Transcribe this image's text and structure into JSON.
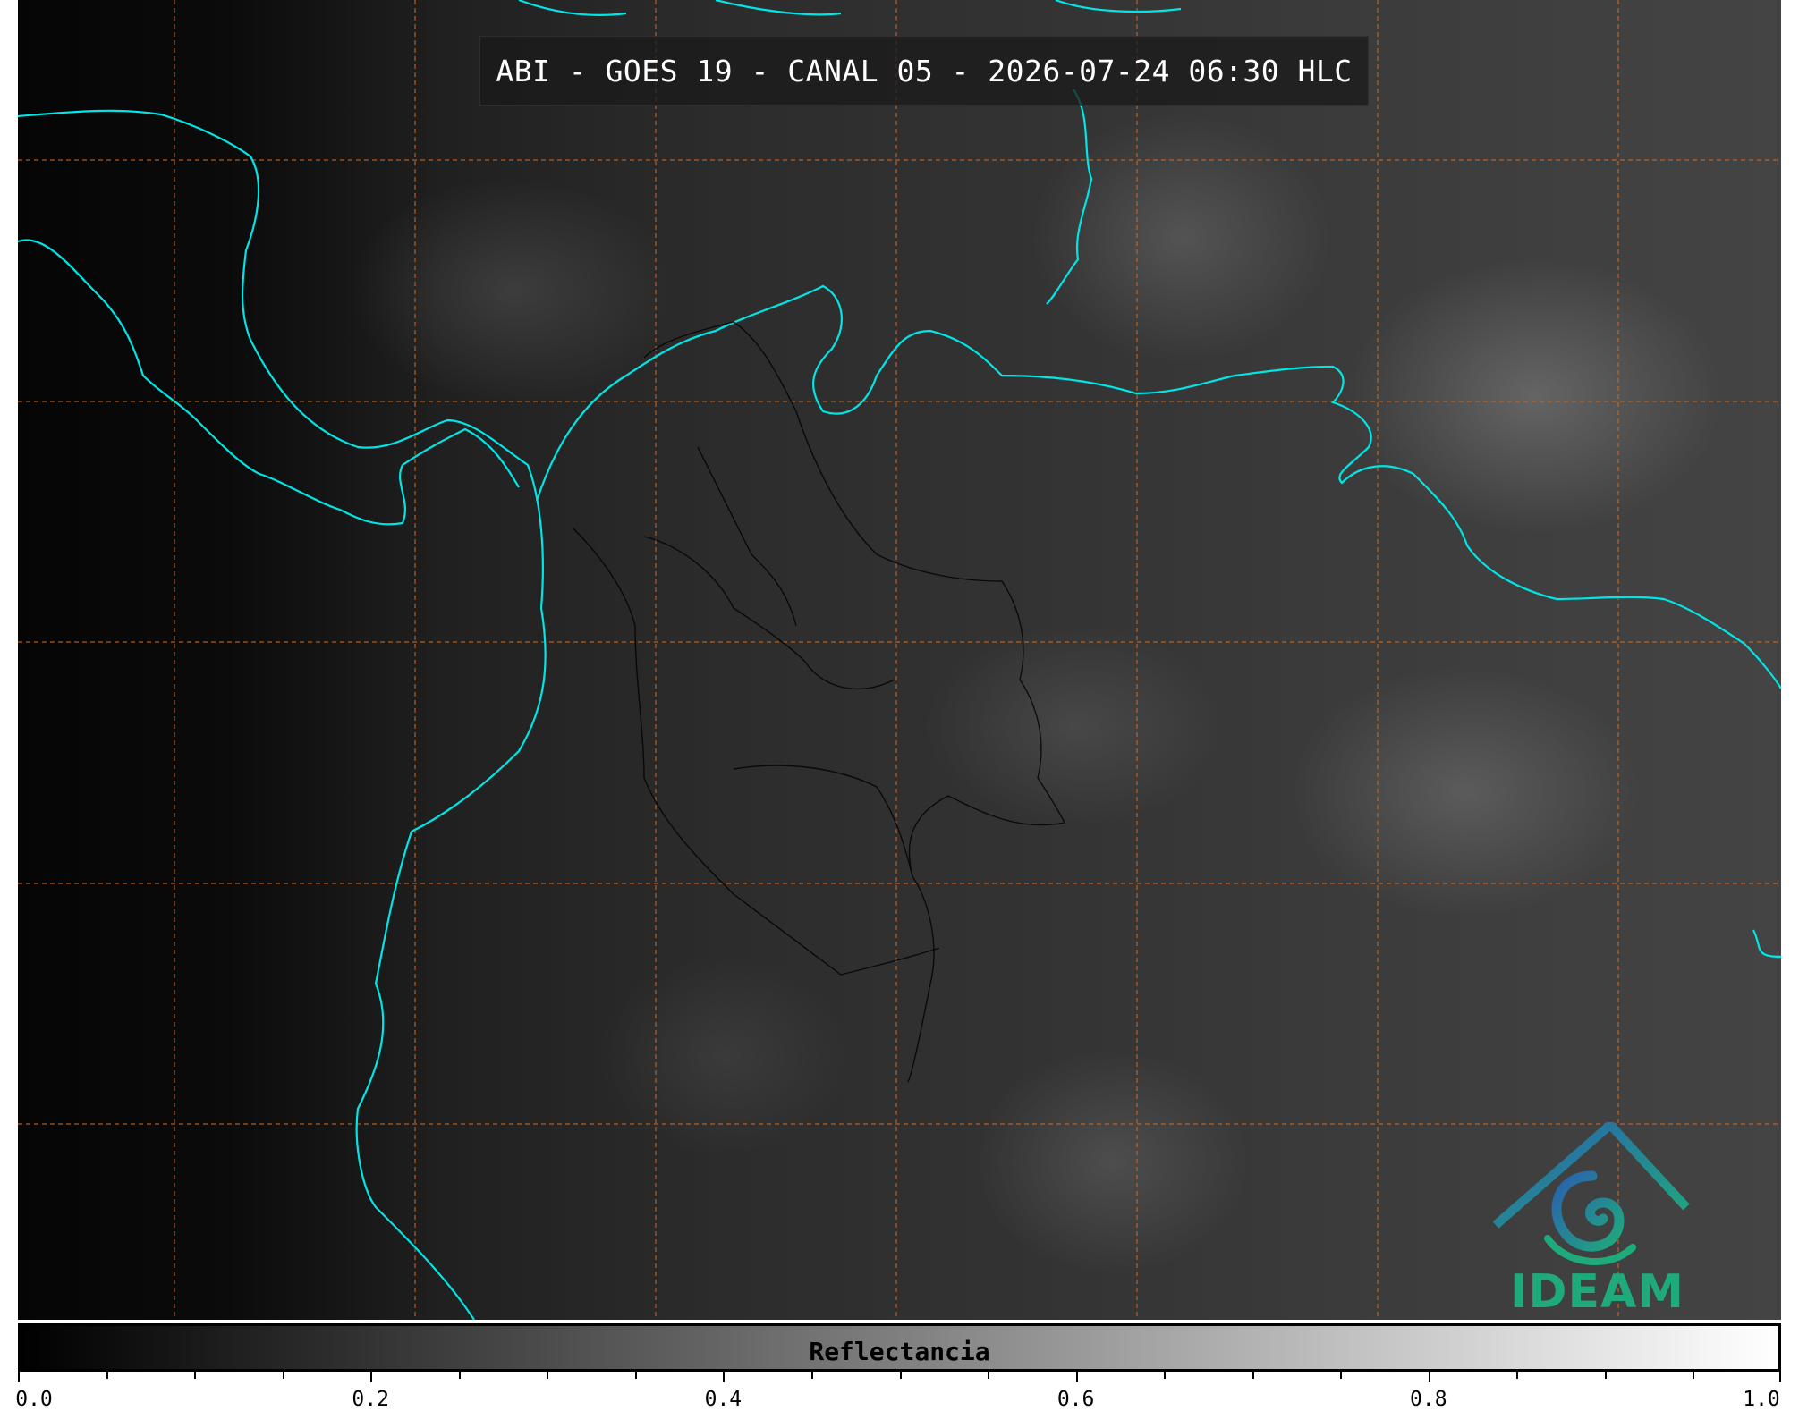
{
  "title": "ABI - GOES 19 - CANAL 05 - 2026-07-24 06:30 HLC",
  "colorbar": {
    "label": "Reflectancia",
    "range": [
      0.0,
      1.0
    ],
    "colormap": "grayscale black-to-white",
    "major_ticks": [
      "0.0",
      "0.2",
      "0.4",
      "0.6",
      "0.8",
      "1.0"
    ],
    "minor_tick_step": 0.05
  },
  "logo": {
    "text": "IDEAM",
    "color": "#1faa7c"
  },
  "map": {
    "coastline_color": "#00e5e5",
    "grid_color": "#d2691e",
    "border_color": "#000000"
  }
}
